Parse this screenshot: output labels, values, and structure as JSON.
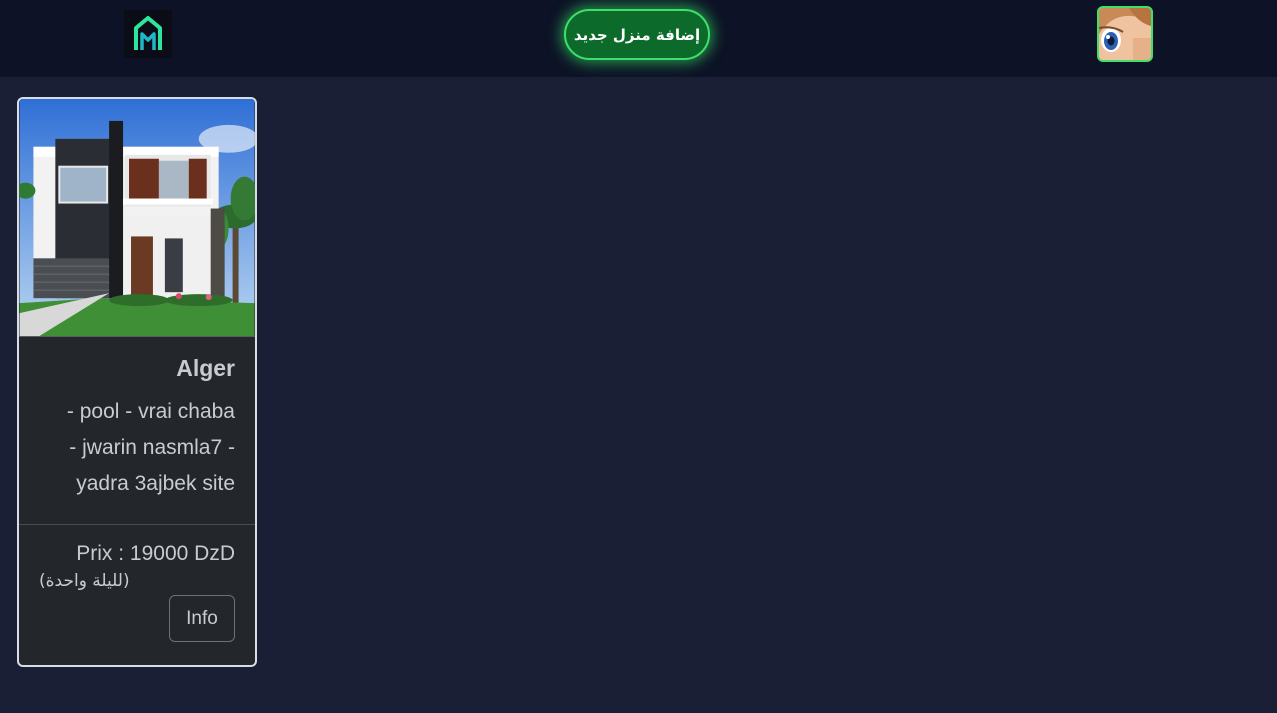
{
  "navbar": {
    "logo_icon": "house-logo-icon",
    "add_button_label": "إضافة منزل جديد",
    "avatar_icon": "user-avatar-icon",
    "accent_color": "#3fe06a"
  },
  "listings": [
    {
      "image_icon": "house-photo",
      "city": "Alger",
      "description_lines": [
        "- pool - vrai chaba",
        "- jwarin nasmla7 -",
        "yadra 3ajbek site"
      ],
      "price": "Prix : 19000 DzD",
      "per_night": "(لليلة واحدة)",
      "info_label": "Info"
    }
  ]
}
